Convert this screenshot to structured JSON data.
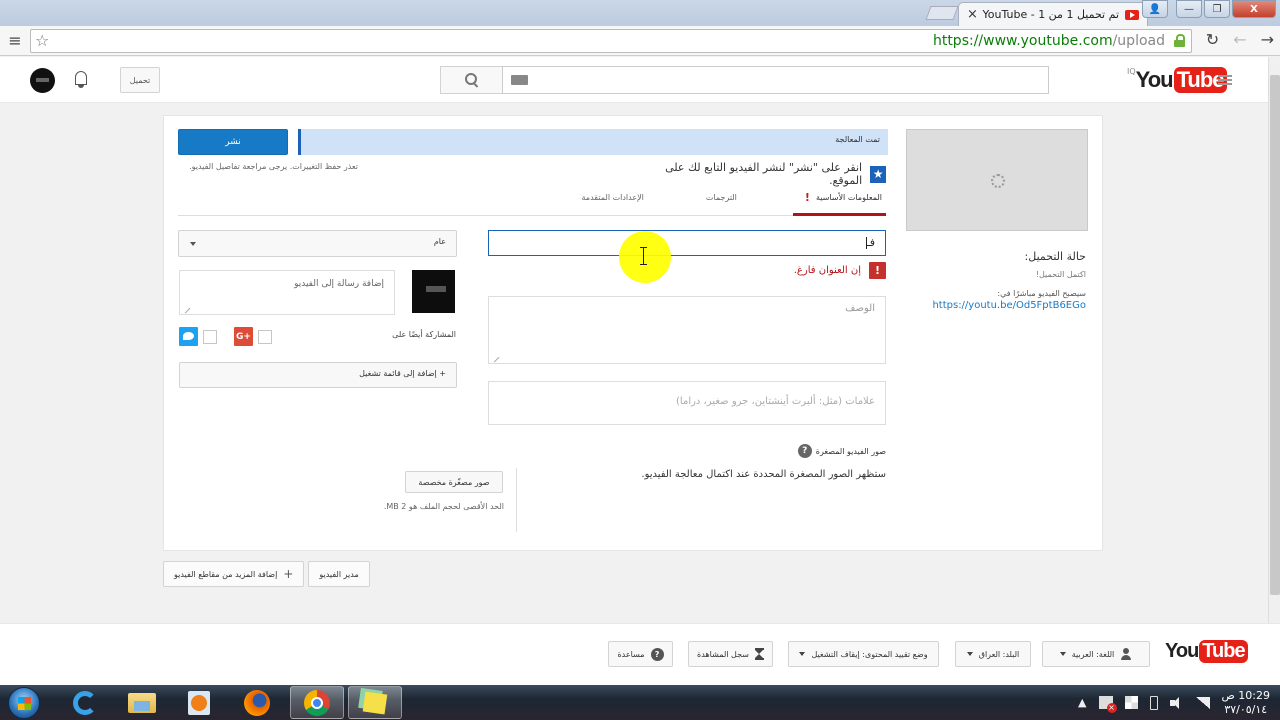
{
  "browser": {
    "tab_title": "تم تحميل 1 من 1 - YouTube",
    "tab_close": "×",
    "url_host": "https://www.youtube.com",
    "url_path": "/upload",
    "window_buttons": {
      "minimize": "—",
      "maximize": "❐",
      "close": "X"
    }
  },
  "masthead": {
    "upload_label": "تحميل",
    "search_placeholder": "",
    "logo_you": "You",
    "logo_tube": "Tube",
    "logo_country": "IQ"
  },
  "upload": {
    "progress_label": "تمت المعالجة",
    "progress_percent": 100,
    "publish_label": "نشر",
    "save_note": "تعذر حفظ التغييرات. يرجى مراجعة تفاصيل الفيديو.",
    "hint": "انقر على \"نشر\" لنشر الفيديو التابع لك على الموقع.",
    "tabs": [
      {
        "label": "المعلومات الأساسية",
        "active": true,
        "warning": true
      },
      {
        "label": "الترجمات",
        "active": false,
        "warning": false
      },
      {
        "label": "الإعدادات المتقدمة",
        "active": false,
        "warning": false
      }
    ],
    "title_value": "فـ",
    "title_error": "إن العنوان فارغ.",
    "description_placeholder": "الوصف",
    "tags_placeholder": "علامات (مثل: ألبرت أينشتاين، جرو صغير، دراما)",
    "thumbnails_heading": "صور الفيديو المصغرة",
    "thumbnails_note": "ستظهر الصور المصغرة المحددة عند اكتمال معالجة الفيديو.",
    "custom_thumbnail_label": "صور مصغّرة مخصصة",
    "max_size_note": "الحد الأقصى لحجم الملف هو 2 MB.",
    "privacy_value": "عام",
    "message_placeholder": "إضافة رسالة إلى الفيديو",
    "share_label": "المشاركة أيضًا على",
    "share_networks": [
      "Google+",
      "Twitter"
    ],
    "playlist_label": "+ إضافة إلى قائمة تشغيل",
    "status_label": "حالة التحميل:",
    "status_value": "اكتمل التحميل!",
    "watch_label": "سيصبح الفيديو مباشرًا في:",
    "watch_url": "https://youtu.be/Od5FptB6EGo"
  },
  "below": {
    "add_more_label": "إضافة المزيد من مقاطع الفيديو",
    "video_manager_label": "مدير الفيديو"
  },
  "footer": {
    "logo_you": "You",
    "logo_tube": "Tube",
    "language": "اللغة: العربية",
    "country": "البلد: العراق",
    "restricted": "وضع تقييد المحتوى: إيقاف التشغيل",
    "history": "سجل المشاهدة",
    "help": "مساعدة"
  },
  "taskbar": {
    "apps": [
      "Internet Explorer",
      "Windows Explorer",
      "Windows Media Player",
      "Firefox",
      "Chrome",
      "Sticky Notes"
    ],
    "active_app": "Chrome",
    "time": "10:29 ص",
    "date": "٣٧/٠٥/١٤"
  },
  "colors": {
    "accent_blue": "#167ac6",
    "youtube_red": "#e62117",
    "error_red": "#b31217"
  }
}
